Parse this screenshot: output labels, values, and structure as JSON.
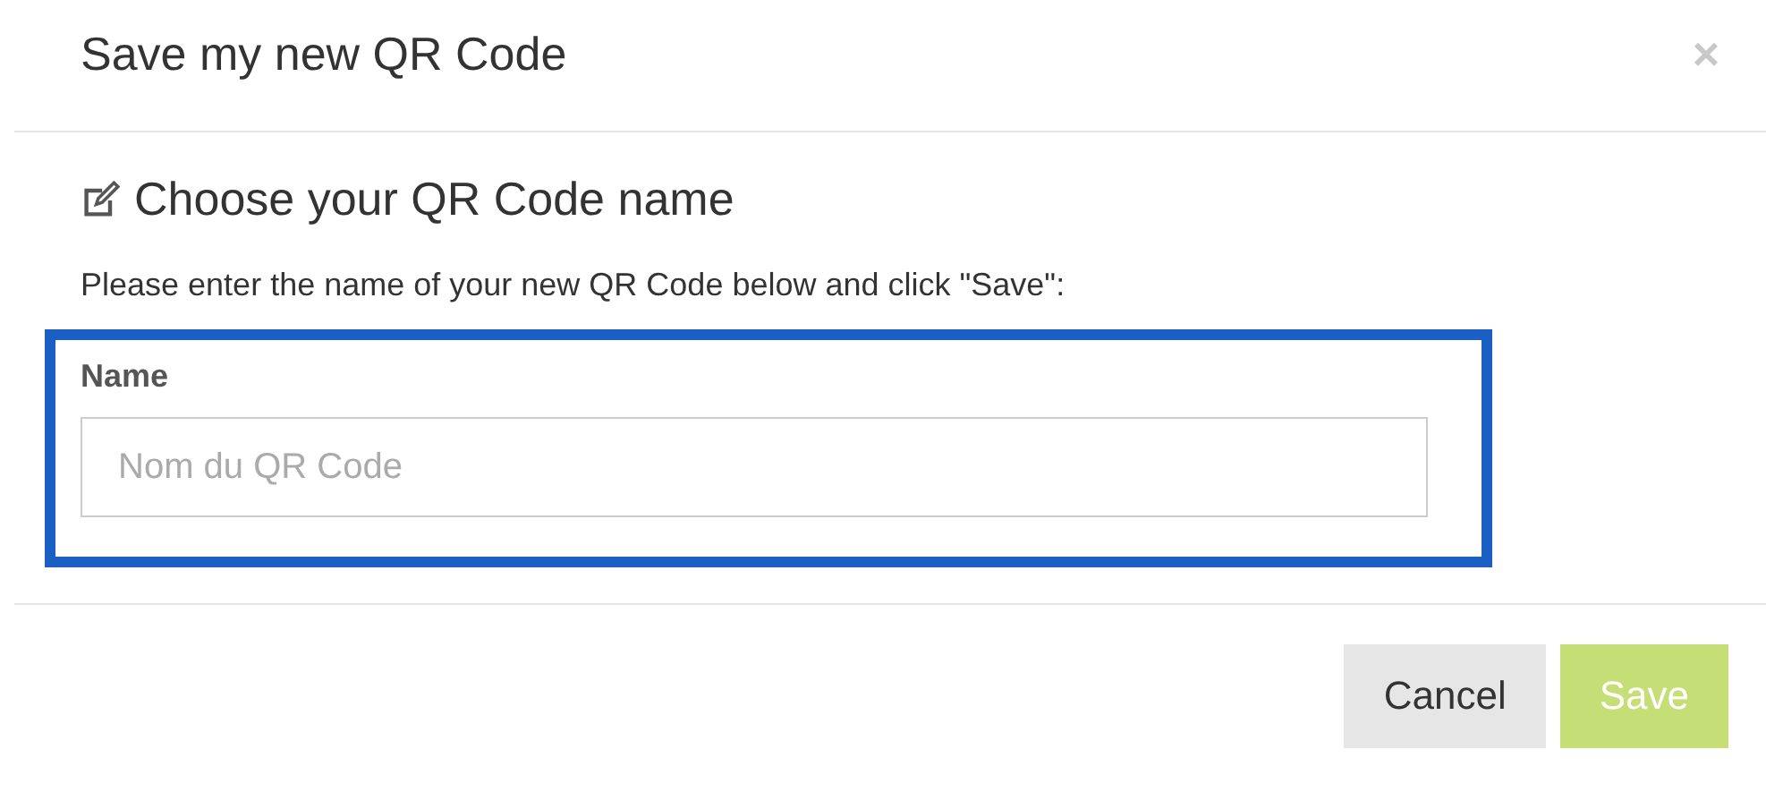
{
  "modal": {
    "title": "Save my new QR Code",
    "close": "×"
  },
  "section": {
    "heading": "Choose your QR Code name",
    "instruction": "Please enter the name of your new QR Code below and click \"Save\":"
  },
  "field": {
    "label": "Name",
    "placeholder": "Nom du QR Code",
    "highlighted": true
  },
  "buttons": [
    {
      "label": "Cancel",
      "kind": "default",
      "disabled": false
    },
    {
      "label": "Save",
      "kind": "primary",
      "disabled": true
    }
  ]
}
